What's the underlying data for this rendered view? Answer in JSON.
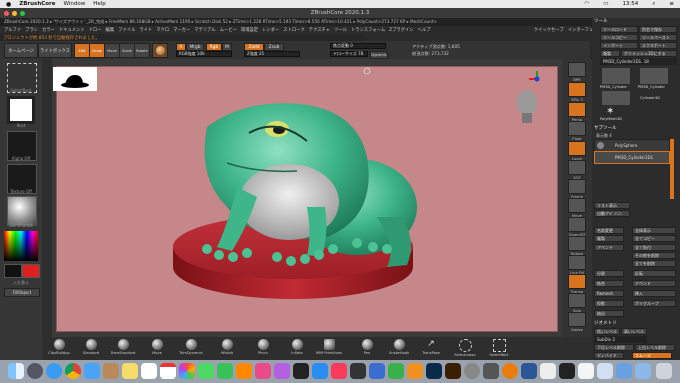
{
  "mac_menubar": {
    "app_name": "ZBrushCore",
    "items": [
      "Window",
      "Help"
    ],
    "status_time": "13:54"
  },
  "window": {
    "title": "ZBrushCore 2020.1.3"
  },
  "infobar": {
    "text": "ZBrushCore 2020.1.3 ▸ 'サイズアウトト' _2R_完成 ▸ FreeMem 86.168GB ▸ ActiveMem 1195 ▸ Scratch Disk 52 ▸ ZTime>1.228 RTime>5.193 Timer>8.556 ATime>10.421 ▸ PolyCount>273.727 KP ▸ MeshCount>"
  },
  "menu_row": {
    "items": [
      "アルファ",
      "ブラシ",
      "カラー",
      "ドキュメント",
      "ドロー",
      "編集",
      "ファイル",
      "ライト",
      "マクロ",
      "マーカー",
      "マテリアル",
      "ムービー",
      "環境設定",
      "レンダー",
      "ストローク",
      "テクスチャ",
      "ツール",
      "トランスフォーム",
      "Zプラグイン",
      "ヘルプ"
    ],
    "right_items": [
      "クイックセーブ",
      "インターフェースの透明度",
      "Menus",
      "DefaultZScript"
    ]
  },
  "notice": "プロジェクトが約 853 秒で自動保存されました。",
  "toolbar": {
    "home_page": "ホームページ",
    "lightbox": "ライトボックス",
    "edit": "Edit",
    "draw": "Draw",
    "move": "Move",
    "scale": "Scale",
    "rotate": "Rotate",
    "a_label": "A",
    "mrgb": "Mrgb",
    "rgb": "Rgb",
    "m": "M",
    "zadd": "Zadd",
    "zsub": "Zsub",
    "rgb_intensity": "RGB強度 100",
    "z_intensity": "Z強度 25",
    "focal_shift": "焦点変動 0",
    "draw_size": "ドローサイズ 78",
    "dynamic": "Dynamic",
    "active_points": "アクティブ頂点数: 1,605",
    "total_points": "総頂点数: 273,732"
  },
  "left_panel": {
    "select_rect": "SelectRect",
    "brush_icon": "Rect",
    "alpha_off": "Alpha Off",
    "texture_off": "Texture Off",
    "material": "SkinShade4",
    "switch_color": "入れ替え",
    "fill_object": "FillObject"
  },
  "right_icons": [
    {
      "label": "BPR"
    },
    {
      "label": "SPix 3"
    },
    {
      "label": "Persp"
    },
    {
      "label": "Floor"
    },
    {
      "label": "Local"
    },
    {
      "label": "XYZ"
    },
    {
      "label": "Frame"
    },
    {
      "label": "Move"
    },
    {
      "label": "Zoom3D"
    },
    {
      "label": "Rotate"
    },
    {
      "label": "Line Fill"
    },
    {
      "label": "Transp"
    },
    {
      "label": "Solo"
    },
    {
      "label": "Xpose"
    }
  ],
  "tool_panel": {
    "header": "ツール",
    "load_tool": "ツールロード",
    "save_as": "別名で保存",
    "copy_tool": "ツールコピー",
    "paste_tool": "ツールペースト",
    "import": "インポート",
    "export": "エクスポート",
    "clone": "複製",
    "make_polymesh": "ポリメッシュ3Dにする",
    "current_tool": "PM3D_Cylinder3D1. 18",
    "thumbs": [
      "PM3D_Cylinder",
      "PM3D_Cylinder",
      "Cylinder3D",
      "PolyMesh3D"
    ],
    "subtool_header": "サブツール",
    "visible_count": "表示数 4",
    "subtools": [
      "PolySphere",
      "PM3D_Cylinder3D1"
    ],
    "list_all": "リスト表示",
    "auto_collapse": "自動アイ ハン",
    "rename": "名前変更",
    "duplicate": "複製",
    "append": "アペンド",
    "split": "分割",
    "merge": "結合",
    "remesh": "Remesh",
    "project": "投影",
    "extract": "抽出",
    "geometry_header": "ジオメトリ",
    "lower_res": "低いレベル",
    "higher_res": "高いレベル",
    "divide": "ディバイド",
    "smooth": "スムーズ",
    "deformation": "変形",
    "all_lower": "全て低いレベル",
    "all_higher": "全て高いレベル",
    "smt": "Smt",
    "del_lower": "下位レベル削除",
    "del_higher": "上位レベル削除",
    "sdiv": "SubDiv 2",
    "extra": [
      "全体表示",
      "全てコピー",
      "全て貼付",
      "その他を削除",
      "全てを削除",
      "反転",
      "アペンド",
      "挿入",
      "ポリグループ"
    ]
  },
  "bottom_shelf": {
    "brushes": [
      "ClayBuildup",
      "Standard",
      "DamStandard",
      "Move",
      "TrimDynamic",
      "hPolish",
      "Pinch",
      "Inflate",
      "IMM Primitives",
      "Pen",
      "SnakeHook",
      "TransPose",
      "SelectLasso",
      "SelectRect"
    ]
  },
  "dock": {
    "icon_count": 36
  },
  "colors": {
    "canvas_bg": "#c5878a",
    "accent": "#d8731f",
    "frog": "#3fb58a",
    "pedestal": "#b3262d"
  }
}
